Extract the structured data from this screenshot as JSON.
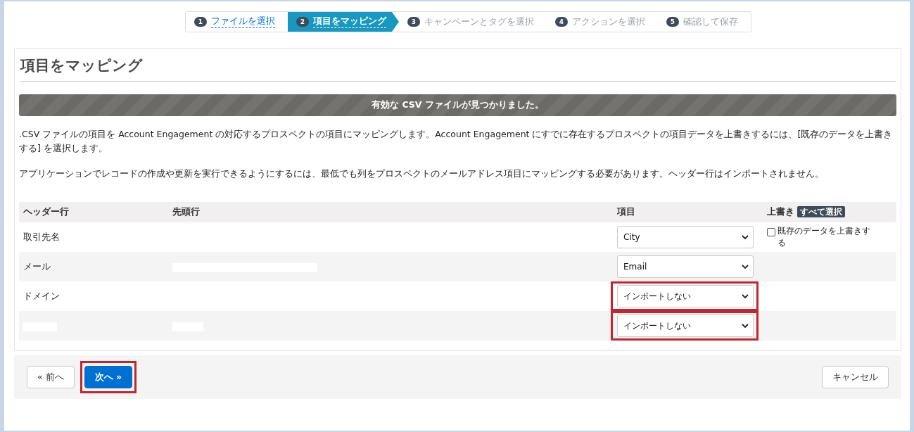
{
  "steps": [
    {
      "number": "1",
      "label": "ファイルを選択",
      "completed": true,
      "selected": false
    },
    {
      "number": "2",
      "label": "項目をマッピング",
      "completed": false,
      "selected": true
    },
    {
      "number": "3",
      "label": "キャンペーンとタグを選択",
      "completed": false,
      "selected": false
    },
    {
      "number": "4",
      "label": "アクションを選択",
      "completed": false,
      "selected": false
    },
    {
      "number": "5",
      "label": "確認して保存",
      "completed": false,
      "selected": false
    }
  ],
  "title": "項目をマッピング",
  "banner": "有効な CSV ファイルが見つかりました。",
  "paragraphs": [
    ".CSV ファイルの項目を Account Engagement の対応するプロスペクトの項目にマッピングします。Account Engagement にすでに存在するプロスペクトの項目データを上書きするには、[既存のデータを上書きする] を選択します。",
    "アプリケーションでレコードの作成や更新を実行できるようにするには、最低でも列をプロスペクトのメールアドレス項目にマッピングする必要があります。ヘッダー行はインポートされません。"
  ],
  "table": {
    "columns": [
      "ヘッダー行",
      "先頭行",
      "項目",
      "上書き"
    ],
    "select_all": "すべて選択",
    "rows": [
      {
        "header": "取引先名",
        "header_redacted": false,
        "first_row_redacted": false,
        "field": "City",
        "highlighted": false,
        "overwrite": {
          "label": "既存のデータを上書きする",
          "checked": false
        }
      },
      {
        "header": "メール",
        "header_redacted": false,
        "first_row_redacted": true,
        "field": "Email",
        "highlighted": false
      },
      {
        "header": "ドメイン",
        "header_redacted": false,
        "first_row_redacted": false,
        "field": "インポートしない",
        "highlighted": true
      },
      {
        "header_redacted": true,
        "first_row_redacted": true,
        "field": "インポートしない",
        "highlighted": true
      }
    ]
  },
  "buttons": {
    "back": {
      "label": "« 前へ",
      "highlighted": false
    },
    "next": {
      "label": "次へ »",
      "highlighted": true
    },
    "cancel": {
      "label": "キャンセル",
      "highlighted": false
    }
  }
}
